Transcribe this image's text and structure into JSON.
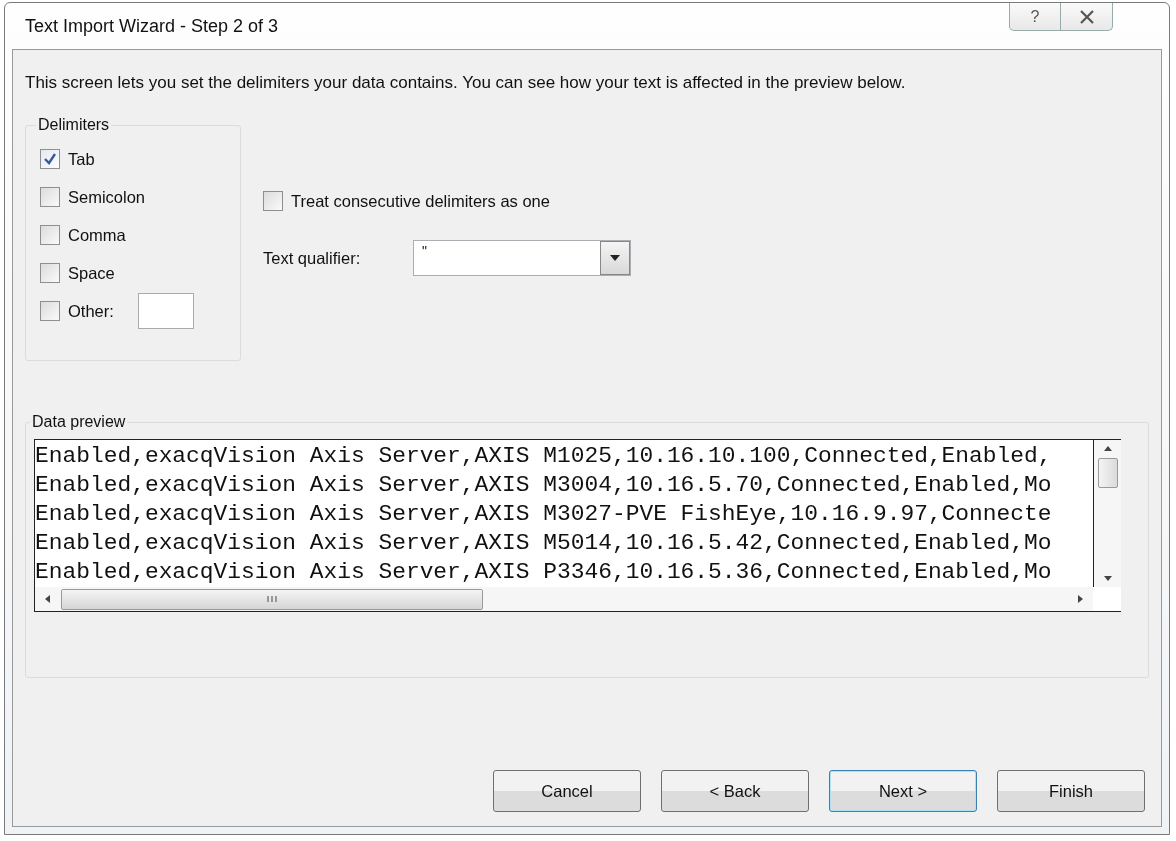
{
  "window": {
    "title": "Text Import Wizard - Step 2 of 3",
    "controls": [
      {
        "kind": "help",
        "label": "?"
      }
    ]
  },
  "intro": "This screen lets you set the delimiters your data contains.  You can see how your text is affected in the preview below.",
  "delimiters": {
    "title": "Delimiters",
    "items": [
      {
        "label": "Tab",
        "checked": true
      },
      {
        "label": "Semicolon",
        "checked": false
      },
      {
        "label": "Comma",
        "checked": false
      },
      {
        "label": "Space",
        "checked": false
      },
      {
        "label": "Other:",
        "checked": false,
        "has_field": true
      }
    ]
  },
  "consecutive": {
    "label": "Treat consecutive delimiters as one",
    "checked": false
  },
  "qualifier": {
    "label": "Text qualifier:",
    "value": "\""
  },
  "preview": {
    "title": "Data preview",
    "lines": [
      "Enabled,exacqVision Axis Server,AXIS M1025,10.16.10.100,Connected,Enabled,",
      "Enabled,exacqVision Axis Server,AXIS M3004,10.16.5.70,Connected,Enabled,Mo",
      "Enabled,exacqVision Axis Server,AXIS M3027-PVE FishEye,10.16.9.97,Connecte",
      "Enabled,exacqVision Axis Server,AXIS M5014,10.16.5.42,Connected,Enabled,Mo",
      "Enabled,exacqVision Axis Server,AXIS P3346,10.16.5.36,Connected,Enabled,Mo"
    ]
  },
  "buttons": [
    {
      "label": "Cancel",
      "default": false
    },
    {
      "label": "< Back",
      "default": false
    },
    {
      "label": "Next >",
      "default": true
    },
    {
      "label": "Finish",
      "default": false
    }
  ]
}
